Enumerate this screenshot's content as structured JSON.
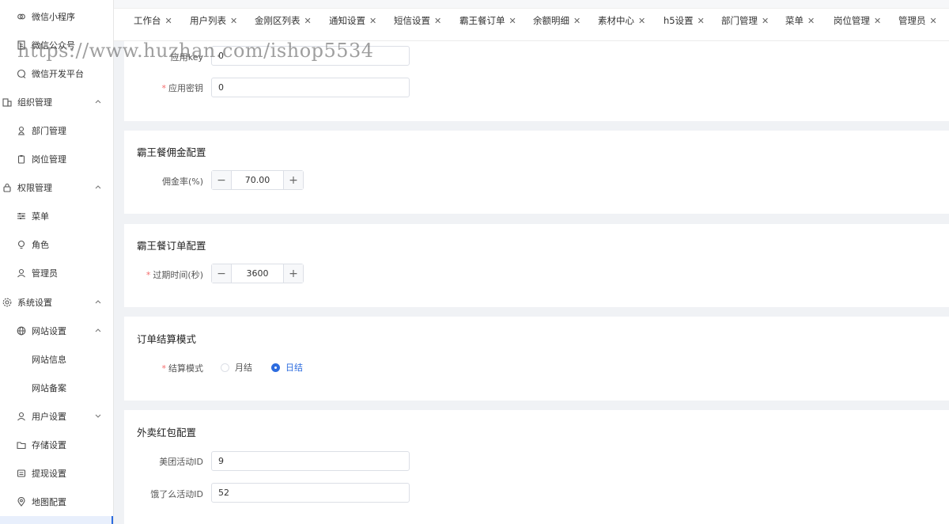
{
  "sidebar": {
    "items": [
      {
        "label": "微信小程序",
        "icon": "miniprogram-icon"
      },
      {
        "label": "微信公众号",
        "icon": "document-icon"
      },
      {
        "label": "微信开发平台",
        "icon": "chat-icon"
      },
      {
        "label": "组织管理",
        "icon": "building-icon"
      },
      {
        "label": "部门管理",
        "icon": "user-icon"
      },
      {
        "label": "岗位管理",
        "icon": "badge-icon"
      },
      {
        "label": "权限管理",
        "icon": "lock-icon"
      },
      {
        "label": "菜单",
        "icon": "sliders-icon"
      },
      {
        "label": "角色",
        "icon": "bulb-icon"
      },
      {
        "label": "管理员",
        "icon": "admin-icon"
      },
      {
        "label": "系统设置",
        "icon": "gear-icon"
      },
      {
        "label": "网站设置",
        "icon": "globe-icon"
      },
      {
        "label": "网站信息"
      },
      {
        "label": "网站备案"
      },
      {
        "label": "用户设置",
        "icon": "users-icon"
      },
      {
        "label": "存储设置",
        "icon": "folder-icon"
      },
      {
        "label": "提现设置",
        "icon": "withdraw-icon"
      },
      {
        "label": "地图配置",
        "icon": "map-pin-icon"
      }
    ]
  },
  "tabs": [
    {
      "label": "工作台"
    },
    {
      "label": "用户列表"
    },
    {
      "label": "金刚区列表"
    },
    {
      "label": "通知设置"
    },
    {
      "label": "短信设置"
    },
    {
      "label": "霸王餐订单"
    },
    {
      "label": "余额明细"
    },
    {
      "label": "素材中心"
    },
    {
      "label": "h5设置"
    },
    {
      "label": "部门管理"
    },
    {
      "label": "菜单"
    },
    {
      "label": "岗位管理"
    },
    {
      "label": "管理员"
    }
  ],
  "top_section": {
    "app_key_label": "应用key",
    "app_key_value": "0",
    "app_secret_label": "应用密钥",
    "app_secret_value": "0"
  },
  "commission": {
    "title": "霸王餐佣金配置",
    "rate_label": "佣金率(%)",
    "rate_value": "70.00"
  },
  "order": {
    "title": "霸王餐订单配置",
    "expire_label": "过期时间(秒)",
    "expire_value": "3600"
  },
  "settlement": {
    "title": "订单结算模式",
    "mode_label": "结算模式",
    "options": [
      "月结",
      "日结"
    ],
    "selected": "日结"
  },
  "redpacket": {
    "title": "外卖红包配置",
    "meituan_label": "美团活动ID",
    "meituan_value": "9",
    "eleme_label": "饿了么活动ID",
    "eleme_value": "52"
  },
  "watermark": "https://www.huzhan.com/ishop5534",
  "colors": {
    "accent": "#2d6cdf",
    "required": "#f56c6c"
  }
}
